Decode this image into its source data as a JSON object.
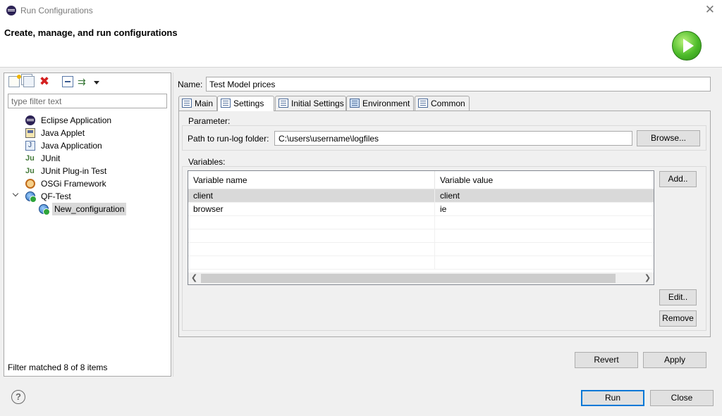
{
  "window": {
    "title": "Run Configurations",
    "close_glyph": "✕"
  },
  "banner": {
    "headline": "Create, manage, and run configurations"
  },
  "toolbar": {
    "icons": [
      "new-launch-config-icon",
      "duplicate-icon",
      "delete-icon",
      "collapse-all-icon",
      "filter-icon",
      "view-menu-icon"
    ],
    "delete_glyph": "✖",
    "filter_glyph": "⇉"
  },
  "filter": {
    "placeholder": "type filter text",
    "value": ""
  },
  "tree": {
    "items": [
      {
        "label": "Eclipse Application",
        "icon": "eclipse-icon"
      },
      {
        "label": "Java Applet",
        "icon": "applet-icon"
      },
      {
        "label": "Java Application",
        "icon": "java-app-icon"
      },
      {
        "label": "JUnit",
        "icon": "junit-icon",
        "glyph": "Ju"
      },
      {
        "label": "JUnit Plug-in Test",
        "icon": "junit-plugin-icon",
        "glyph": "Ju"
      },
      {
        "label": "OSGi Framework",
        "icon": "osgi-icon"
      },
      {
        "label": "QF-Test",
        "icon": "qftest-icon",
        "expanded": true
      },
      {
        "label": "New_configuration",
        "icon": "qftest-config-icon",
        "selected": true
      }
    ],
    "status": "Filter matched 8 of 8 items"
  },
  "config": {
    "name_label": "Name:",
    "name_value": "Test Model prices"
  },
  "tabs": [
    {
      "label": "Main"
    },
    {
      "label": "Settings",
      "active": true
    },
    {
      "label": "Initial Settings"
    },
    {
      "label": "Environment"
    },
    {
      "label": "Common"
    }
  ],
  "settings": {
    "parameter_label": "Parameter:",
    "path_label": "Path to run-log folder:",
    "path_value": "C:\\users\\username\\logfiles",
    "browse_label": "Browse...",
    "variables_label": "Variables:",
    "columns": [
      "Variable name",
      "Variable value"
    ],
    "rows": [
      {
        "name": "client",
        "value": "client"
      },
      {
        "name": "browser",
        "value": "ie"
      }
    ],
    "add_label": "Add..",
    "edit_label": "Edit..",
    "remove_label": "Remove"
  },
  "buttons": {
    "revert": "Revert",
    "apply": "Apply",
    "run": "Run",
    "close": "Close",
    "help_glyph": "?"
  },
  "scroll": {
    "left_arrow": "❮",
    "right_arrow": "❯"
  }
}
